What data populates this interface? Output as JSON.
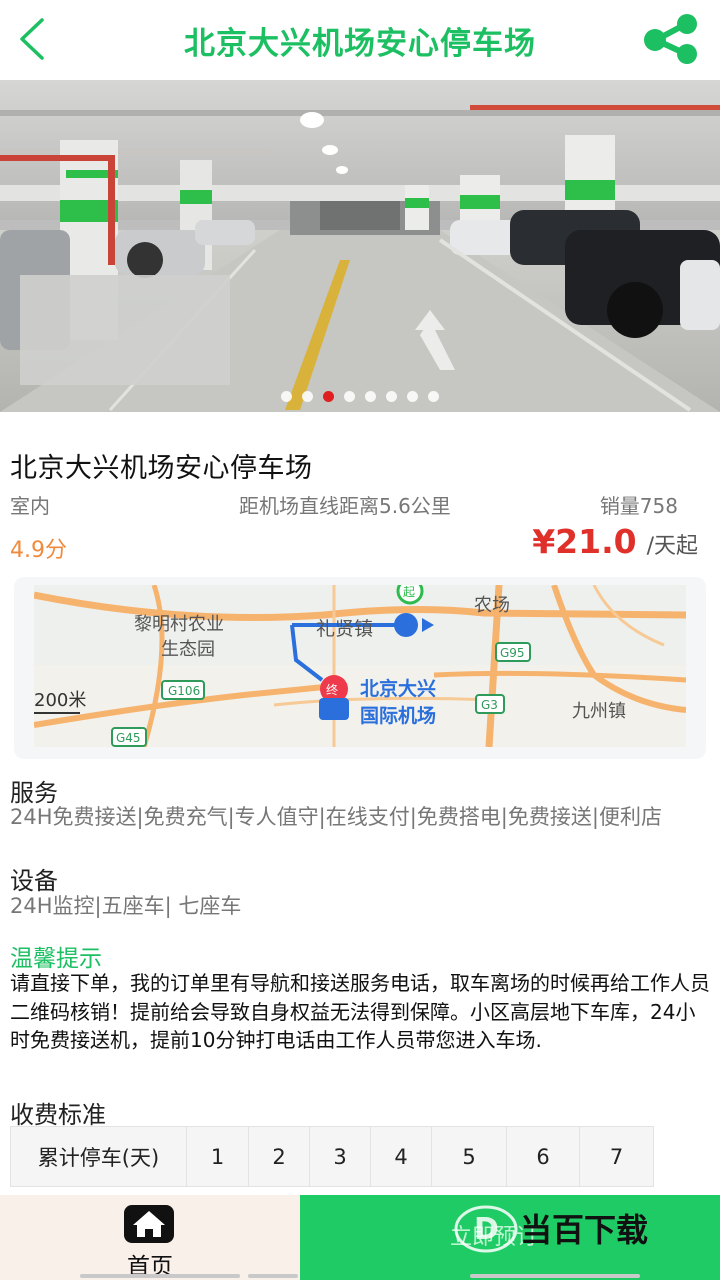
{
  "header": {
    "title": "北京大兴机场安心停车场",
    "back_icon": "chevron-left-icon",
    "share_icon": "share-icon",
    "accent_color": "#1cbf62"
  },
  "banner": {
    "slide_count": 8,
    "active_slide": 3
  },
  "lot": {
    "name": "北京大兴机场安心停车场",
    "type": "室内",
    "distance": "距机场直线距离5.6公里",
    "sales": "销量758",
    "rating": "4.9分",
    "price": "¥21.0",
    "price_unit": "/天起"
  },
  "map": {
    "labels": {
      "village": "黎明村农业",
      "village2": "生态园",
      "town": "礼贤镇",
      "farm": "农场",
      "airport1": "北京大兴",
      "airport2": "国际机场",
      "town2": "九州镇",
      "scale": "200米",
      "start": "起",
      "end": "终"
    },
    "roads": [
      "G106",
      "G95",
      "G3",
      "G45"
    ]
  },
  "services": {
    "title": "服务",
    "text": "24H免费接送|免费充气|专人值守|在线支付|免费搭电|免费接送|便利店"
  },
  "facilities": {
    "title": "设备",
    "text": "24H监控|五座车| 七座车"
  },
  "tips": {
    "title": "温馨提示",
    "text": "请直接下单，我的订单里有导航和接送服务电话，取车离场的时候再给工作人员二维码核销！提前给会导致自身权益无法得到保障。小区高层地下车库，24小时免费接送机，提前10分钟打电话由工作人员带您进入车场."
  },
  "fees": {
    "title": "收费标准",
    "row_header": "累计停车(天)",
    "days": [
      "1",
      "2",
      "3",
      "4",
      "5",
      "6",
      "7"
    ]
  },
  "bottom": {
    "home_label": "首页",
    "home_icon": "home-icon",
    "book_label": "立即预订",
    "watermark": "当百下载",
    "book_color": "#1ecb64"
  }
}
